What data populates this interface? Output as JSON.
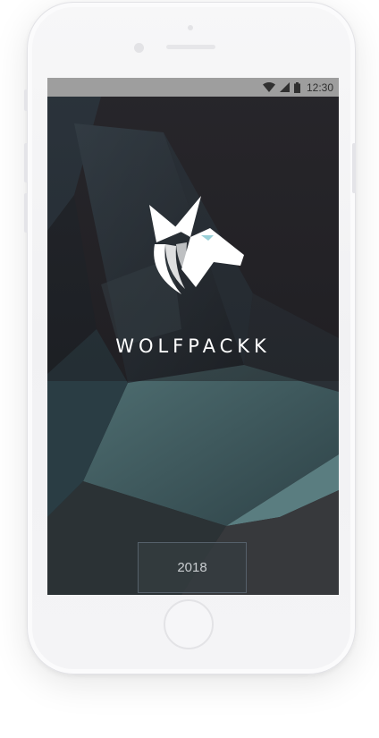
{
  "status_bar": {
    "time": "12:30",
    "icons": [
      "wifi-icon",
      "signal-icon",
      "battery-icon"
    ]
  },
  "splash": {
    "brand_name": "WOLFPACKK",
    "logo_icon": "wolf-head-logo",
    "year": "2018"
  },
  "colors": {
    "status_bar": "#9e9e9e",
    "screen_bg": "#262427",
    "accent_teal": "#4a6e6c",
    "text": "#ffffff"
  }
}
